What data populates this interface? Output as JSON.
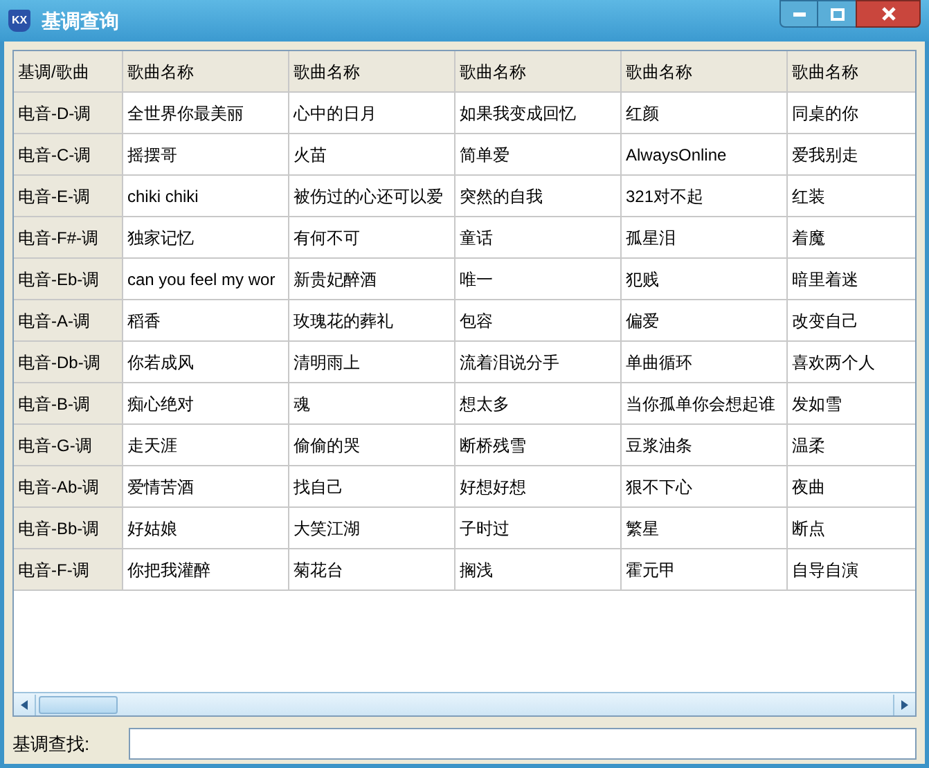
{
  "window": {
    "title": "基调查询",
    "icon_text": "KX"
  },
  "table": {
    "columns": [
      "基调/歌曲",
      "歌曲名称",
      "歌曲名称",
      "歌曲名称",
      "歌曲名称",
      "歌曲名称"
    ],
    "rows": [
      [
        "电音-D-调",
        "全世界你最美丽",
        "心中的日月",
        "如果我变成回忆",
        "红颜",
        "同桌的你"
      ],
      [
        "电音-C-调",
        "摇摆哥",
        "火苗",
        "简单爱",
        "AlwaysOnline",
        "爱我别走"
      ],
      [
        "电音-E-调",
        "chiki chiki",
        "被伤过的心还可以爱",
        "突然的自我",
        "321对不起",
        "红装"
      ],
      [
        "电音-F#-调",
        "独家记忆",
        "有何不可",
        "童话",
        "孤星泪",
        "着魔"
      ],
      [
        "电音-Eb-调",
        "can you feel my wor",
        "新贵妃醉酒",
        "唯一",
        "犯贱",
        "暗里着迷"
      ],
      [
        "电音-A-调",
        "稻香",
        "玫瑰花的葬礼",
        "包容",
        "偏爱",
        "改变自己"
      ],
      [
        "电音-Db-调",
        "你若成风",
        "清明雨上",
        "流着泪说分手",
        "单曲循环",
        "喜欢两个人"
      ],
      [
        "电音-B-调",
        "痴心绝对",
        "魂",
        "想太多",
        "当你孤单你会想起谁",
        "发如雪"
      ],
      [
        "电音-G-调",
        "走天涯",
        "偷偷的哭",
        "断桥残雪",
        "豆浆油条",
        "温柔"
      ],
      [
        "电音-Ab-调",
        "爱情苦酒",
        "找自己",
        "好想好想",
        "狠不下心",
        "夜曲"
      ],
      [
        "电音-Bb-调",
        "好姑娘",
        "大笑江湖",
        "子时过",
        "繁星",
        "断点"
      ],
      [
        "电音-F-调",
        "你把我灌醉",
        "菊花台",
        "搁浅",
        "霍元甲",
        "自导自演"
      ]
    ]
  },
  "search": {
    "label": "基调查找:"
  }
}
